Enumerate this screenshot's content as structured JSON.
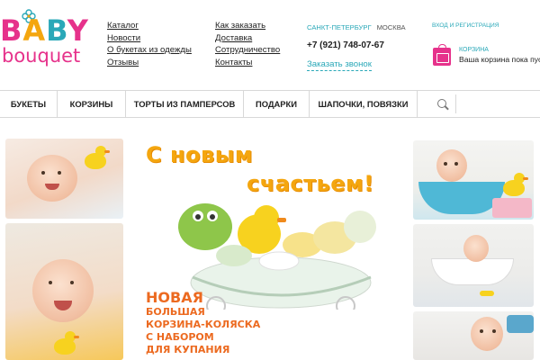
{
  "logo": {
    "word_top_letters": [
      {
        "char": "B",
        "color": "#e6328b"
      },
      {
        "char": "A",
        "color": "#f4a60f"
      },
      {
        "char": "B",
        "color": "#2aa8b8"
      },
      {
        "char": "Y",
        "color": "#e6328b"
      }
    ],
    "word_bottom": "bouquet"
  },
  "nav": {
    "col1": [
      "Каталог",
      "Новости",
      "О букетах из одежды",
      "Отзывы"
    ],
    "col2": [
      "Как заказать",
      "Доставка",
      "Сотрудничество",
      "Контакты"
    ]
  },
  "contacts": {
    "city_active": "Санкт-Петербург",
    "city_other": "Москва",
    "phone": "+7 (921) 748-07-67",
    "callback": "Заказать звонок"
  },
  "account": {
    "login": "Вход и регистрация",
    "cart_title": "Корзина",
    "cart_status": "Ваша корзина пока пуст"
  },
  "menu": {
    "items": [
      "Букеты",
      "Корзины",
      "Торты из памперсов",
      "Подарки",
      "Шапочки, повязки"
    ],
    "search_placeholder": ""
  },
  "banner": {
    "headline_line1": "С новым",
    "headline_line2": "счастьем!",
    "promo_lines": [
      "Новая",
      "большая",
      "корзина-коляска",
      "с набором",
      "для купания"
    ]
  },
  "colors": {
    "brand_pink": "#e6328b",
    "brand_teal": "#2aa8b8",
    "brand_yellow": "#f4a60f",
    "promo_orange": "#ec6a20"
  }
}
